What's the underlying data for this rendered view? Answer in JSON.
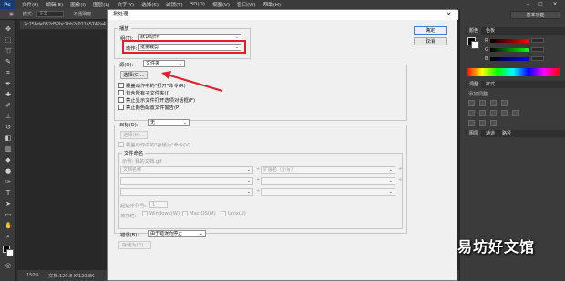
{
  "app": {
    "logo": "Ps",
    "menus": [
      "文件(F)",
      "编辑(E)",
      "图像(I)",
      "图层(L)",
      "文字(Y)",
      "选择(S)",
      "滤镜(T)",
      "3D(D)",
      "视图(V)",
      "窗口(W)",
      "帮助(H)"
    ],
    "window_controls": {
      "minimize": "–",
      "maximize": "□",
      "close": "✕"
    }
  },
  "options_bar": {
    "tolerance_label": "容差:",
    "tolerance_value": "不透明度",
    "items": [
      "模式:",
      "正常"
    ],
    "field_placeholder": ""
  },
  "document_tab": {
    "name": "2c25bde032d52bc7bb2c011a5742a4"
  },
  "status_bar": {
    "zoom": "150%",
    "doc_info": "文档:120.8 K/120.8K"
  },
  "right_dock": {
    "workspace": "基本功能",
    "color_tabs": [
      "颜色",
      "色板"
    ],
    "sliders": [
      "R",
      "G",
      "B"
    ],
    "adjust_tabs": [
      "调整",
      "样式"
    ],
    "adjust_hint": "添加调整",
    "layer_tabs": [
      "图层",
      "通道",
      "路径"
    ]
  },
  "dialog": {
    "title": "批处理",
    "close_glyph": "✕",
    "play_group": "播放",
    "set_label": "组(T):",
    "set_value": "默认动作",
    "action_label": "动作:",
    "action_value": "批量裁剪",
    "ok_label": "确定",
    "cancel_label": "取消",
    "source_label": "源(O):",
    "source_value": "文件夹",
    "choose_label": "选择(C)...",
    "checkboxes": [
      "覆盖动作中的\"打开\"命令(R)",
      "包含所有子文件夹(I)",
      "禁止显示文件打开选项对话框(F)",
      "禁止颜色配置文件警告(P)"
    ],
    "dest_label": "目标(D):",
    "dest_value": "无",
    "dest_choose_label": "选择(H)...",
    "dest_override": "覆盖动作中的\"存储为\"命令(V)",
    "file_naming_label": "文件命名",
    "example_label": "示例: 我的文档.gif",
    "naming_row1_left": "文档名称",
    "naming_row1_right": "扩展名（小写）",
    "plus": "+",
    "serial_label": "起始序列号:",
    "serial_value": "1",
    "compat_label": "兼容性:",
    "compat_options": [
      "Windows(W)",
      "Mac OS(M)",
      "Unix(U)"
    ],
    "errors_label": "错误(B):",
    "errors_value": "由于错误而停止",
    "save_as_label": "存储为(E)..."
  },
  "watermark": "易坊好文馆",
  "colors": {
    "highlight_box": "#e0202a",
    "arrow": "#e0202a",
    "ps_chrome": "#3b3b3b",
    "dialog_bg": "#f0f0f0"
  }
}
